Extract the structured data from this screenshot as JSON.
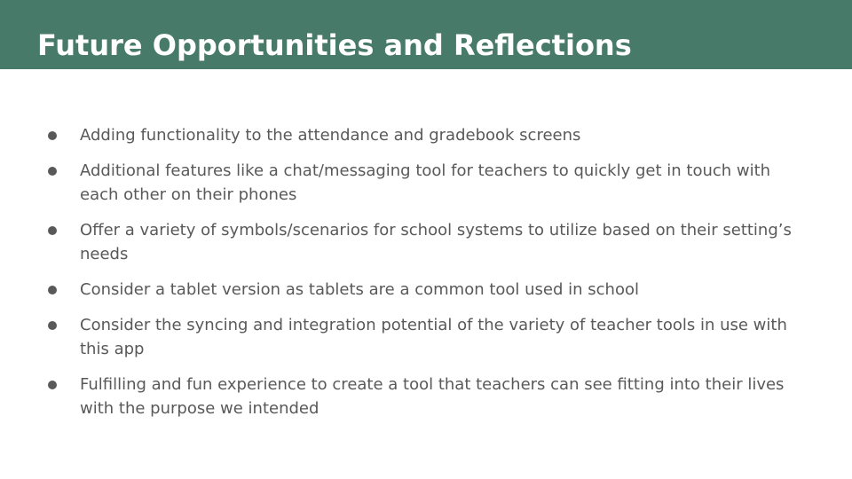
{
  "slide": {
    "title": "Future Opportunities and Reflections",
    "colors": {
      "header_bg": "#487a69",
      "title_text": "#ffffff",
      "body_text": "#595959"
    },
    "bullets": [
      "Adding functionality to the attendance and gradebook screens",
      "Additional features like a chat/messaging tool for teachers to quickly get in touch with each other on their phones",
      "Offer a variety of symbols/scenarios for school systems to utilize based on their setting’s needs",
      "Consider a tablet version as tablets are a common tool used in school",
      "Consider the syncing and integration potential of the variety of teacher tools in use with this app",
      "Fulfilling and fun experience to create a tool that teachers can see fitting into their lives with the purpose we intended"
    ]
  }
}
